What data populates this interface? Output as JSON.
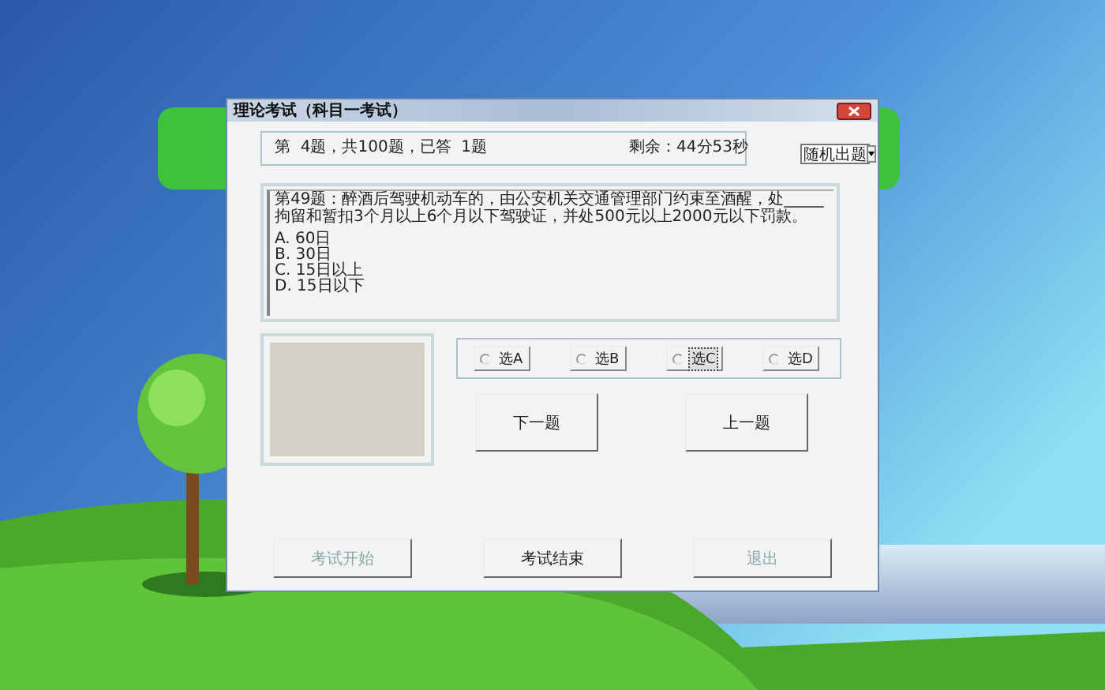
{
  "window": {
    "title": "理论考试（科目一考试）"
  },
  "status": {
    "progress": "第  4题，共100题，已答  1题",
    "remaining": "剩余：44分53秒"
  },
  "mode_select": {
    "value": "随机出题"
  },
  "question": {
    "text": "第49题：醉酒后驾驶机动车的，由公安机关交通管理部门约束至酒醒，处_____拘留和暂扣3个月以上6个月以下驾驶证，并处500元以上2000元以下罚款。",
    "options": [
      "A. 60日",
      "B. 30日",
      "C. 15日以上",
      "D. 15日以下"
    ]
  },
  "answer_options": [
    {
      "label": "选A",
      "checked": false,
      "focused": false
    },
    {
      "label": "选B",
      "checked": false,
      "focused": false
    },
    {
      "label": "选C",
      "checked": false,
      "focused": true
    },
    {
      "label": "选D",
      "checked": false,
      "focused": false
    }
  ],
  "nav_buttons": [
    {
      "label": "下一题"
    },
    {
      "label": "上一题"
    }
  ],
  "bottom_buttons": [
    {
      "label": "考试开始",
      "disabled": true
    },
    {
      "label": "考试结束",
      "disabled": false
    },
    {
      "label": "退出",
      "disabled": true
    }
  ]
}
